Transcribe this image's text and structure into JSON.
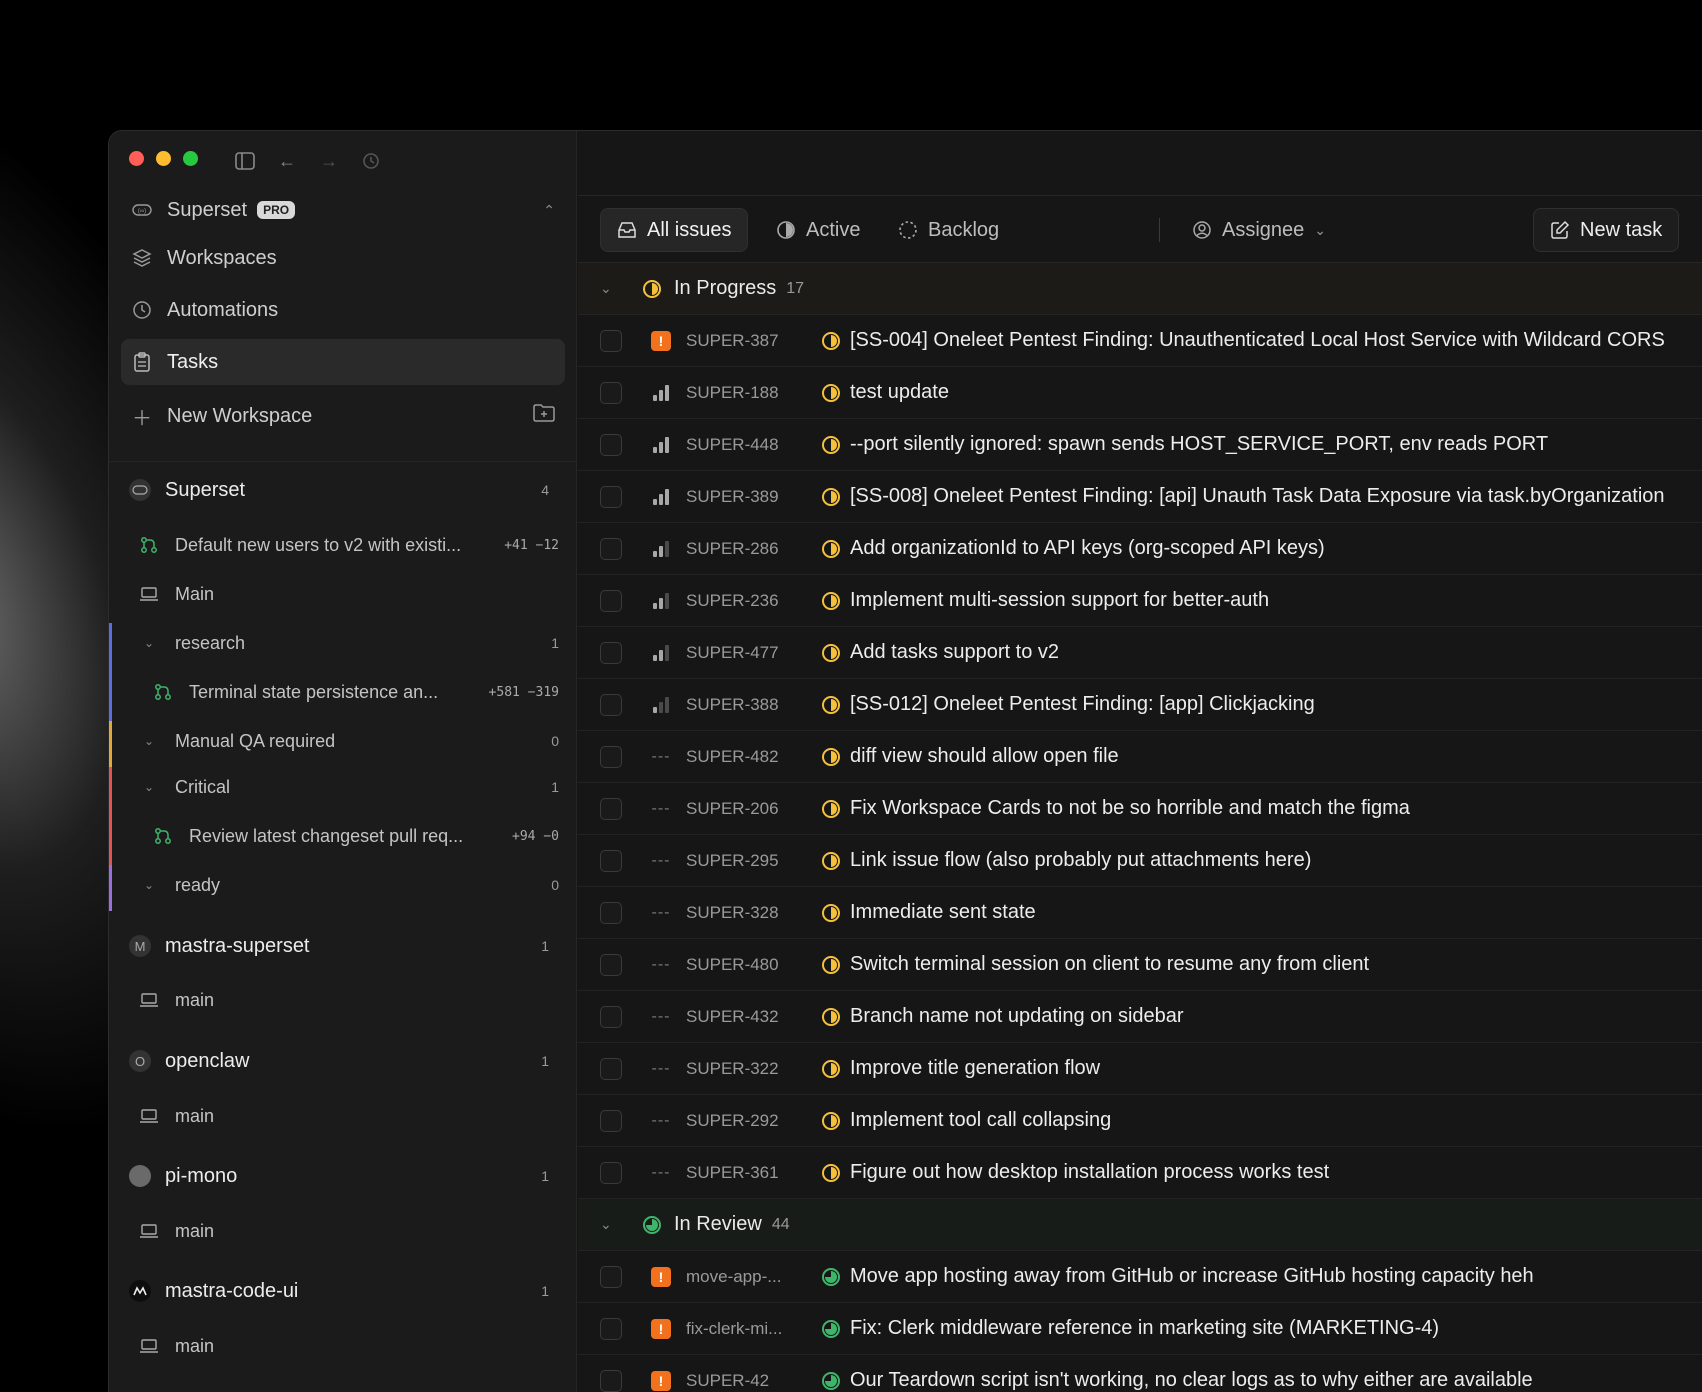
{
  "sidebar": {
    "org": {
      "name": "Superset",
      "badge": "PRO"
    },
    "nav": [
      {
        "label": "Workspaces",
        "icon": "layers-icon"
      },
      {
        "label": "Automations",
        "icon": "clock-icon"
      },
      {
        "label": "Tasks",
        "icon": "clipboard-icon",
        "active": true
      }
    ],
    "new_workspace": "New Workspace",
    "workspaces": [
      {
        "name": "Superset",
        "count": "4",
        "avatar": "",
        "items": [
          {
            "type": "branch",
            "label": "Default new users to v2 with existi...",
            "diff": "+41 −12"
          },
          {
            "type": "local",
            "label": "Main"
          },
          {
            "type": "section",
            "label": "research",
            "count": "1"
          },
          {
            "type": "branch",
            "label": "Terminal state persistence an...",
            "diff": "+581 −319"
          },
          {
            "type": "section",
            "label": "Manual QA required",
            "count": "0"
          },
          {
            "type": "section",
            "label": "Critical",
            "count": "1"
          },
          {
            "type": "branch",
            "label": "Review latest changeset pull req...",
            "diff": "+94 −0"
          },
          {
            "type": "section",
            "label": "ready",
            "count": "0"
          }
        ]
      },
      {
        "name": "mastra-superset",
        "count": "1",
        "avatar": "M",
        "main": "main"
      },
      {
        "name": "openclaw",
        "count": "1",
        "avatar": "O",
        "main": "main"
      },
      {
        "name": "pi-mono",
        "count": "1",
        "avatar": "",
        "main": "main"
      },
      {
        "name": "mastra-code-ui",
        "count": "1",
        "avatar": "",
        "main": "main"
      }
    ]
  },
  "toolbar": {
    "all_issues": "All issues",
    "active": "Active",
    "backlog": "Backlog",
    "assignee": "Assignee",
    "new_task": "New task"
  },
  "groups": {
    "in_progress": {
      "label": "In Progress",
      "count": "17"
    },
    "in_review": {
      "label": "In Review",
      "count": "44"
    }
  },
  "in_progress_rows": [
    {
      "id": "SUPER-387",
      "prio": "urgent",
      "title": "[SS-004] Oneleet Pentest Finding: Unauthenticated Local Host Service with Wildcard CORS"
    },
    {
      "id": "SUPER-188",
      "prio": "high",
      "title": "test update"
    },
    {
      "id": "SUPER-448",
      "prio": "high",
      "title": "--port silently ignored: spawn sends HOST_SERVICE_PORT, env reads PORT"
    },
    {
      "id": "SUPER-389",
      "prio": "high",
      "title": "[SS-008] Oneleet Pentest Finding: [api] Unauth Task Data Exposure via task.byOrganization"
    },
    {
      "id": "SUPER-286",
      "prio": "medium",
      "title": "Add organizationId to API keys (org-scoped API keys)"
    },
    {
      "id": "SUPER-236",
      "prio": "medium",
      "title": "Implement multi-session support for better-auth"
    },
    {
      "id": "SUPER-477",
      "prio": "medium",
      "title": "Add tasks support to v2"
    },
    {
      "id": "SUPER-388",
      "prio": "low",
      "title": "[SS-012] Oneleet Pentest Finding: [app] Clickjacking"
    },
    {
      "id": "SUPER-482",
      "prio": "none",
      "title": "diff view should allow open file"
    },
    {
      "id": "SUPER-206",
      "prio": "none",
      "title": "Fix Workspace Cards to not be so horrible and match the figma"
    },
    {
      "id": "SUPER-295",
      "prio": "none",
      "title": "Link issue flow (also probably put attachments here)"
    },
    {
      "id": "SUPER-328",
      "prio": "none",
      "title": "Immediate sent state"
    },
    {
      "id": "SUPER-480",
      "prio": "none",
      "title": "Switch terminal session on client to resume any from client"
    },
    {
      "id": "SUPER-432",
      "prio": "none",
      "title": "Branch name not updating on sidebar"
    },
    {
      "id": "SUPER-322",
      "prio": "none",
      "title": "Improve title generation flow"
    },
    {
      "id": "SUPER-292",
      "prio": "none",
      "title": "Implement tool call collapsing"
    },
    {
      "id": "SUPER-361",
      "prio": "none",
      "title": "Figure out how desktop installation process works test"
    }
  ],
  "in_review_rows": [
    {
      "id": "move-app-...",
      "prio": "urgent",
      "title": "Move app hosting away from GitHub or increase GitHub hosting capacity heh"
    },
    {
      "id": "fix-clerk-mi...",
      "prio": "urgent",
      "title": "Fix: Clerk middleware reference in marketing site (MARKETING-4)"
    },
    {
      "id": "SUPER-42",
      "prio": "urgent",
      "title": "Our Teardown script isn't working, no clear logs as to why either are available"
    }
  ],
  "colors": {
    "in_progress": "#f5c13d",
    "in_review": "#3fb56b",
    "urgent": "#f2711c",
    "section_research": "#5b6ee1",
    "section_manual_qa": "#e0a93a",
    "section_critical": "#e05555",
    "section_ready": "#9b6ee1"
  }
}
